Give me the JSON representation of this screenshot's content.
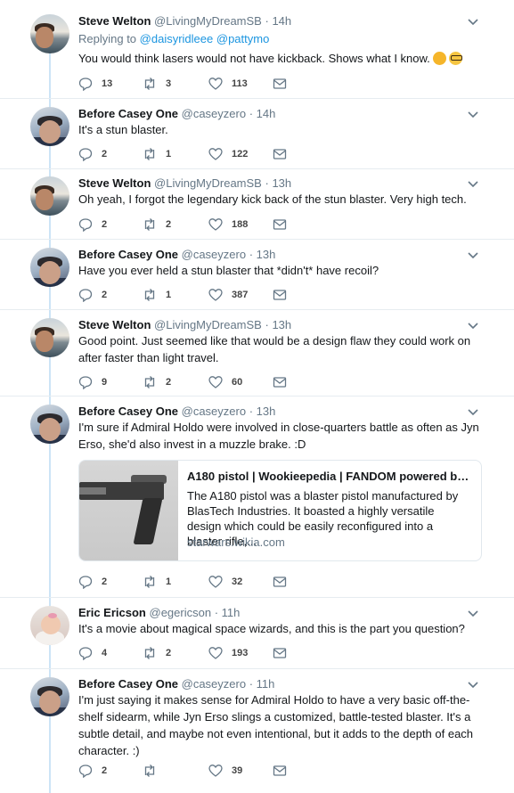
{
  "tweets": [
    {
      "name": "Steve Welton",
      "handle": "@LivingMyDreamSB",
      "time": "14h",
      "replying_label": "Replying to",
      "replying_to": [
        "@daisyridleee",
        "@pattymo"
      ],
      "text": "You would think lasers would not have kickback. Shows what I know.",
      "emojis": [
        "thinking-face-emoji",
        "nerd-face-emoji"
      ],
      "replies": "13",
      "retweets": "3",
      "likes": "113"
    },
    {
      "name": "Before Casey One",
      "handle": "@caseyzero",
      "time": "14h",
      "text": "It's a stun blaster.",
      "replies": "2",
      "retweets": "1",
      "likes": "122"
    },
    {
      "name": "Steve Welton",
      "handle": "@LivingMyDreamSB",
      "time": "13h",
      "text": "Oh yeah, I forgot the legendary kick back of the stun blaster. Very high tech.",
      "replies": "2",
      "retweets": "2",
      "likes": "188"
    },
    {
      "name": "Before Casey One",
      "handle": "@caseyzero",
      "time": "13h",
      "text": "Have you ever held a stun blaster that *didn't* have recoil?",
      "replies": "2",
      "retweets": "1",
      "likes": "387"
    },
    {
      "name": "Steve Welton",
      "handle": "@LivingMyDreamSB",
      "time": "13h",
      "text": "Good point. Just seemed like that would be a design flaw they could work on after faster than light travel.",
      "replies": "9",
      "retweets": "2",
      "likes": "60"
    },
    {
      "name": "Before Casey One",
      "handle": "@caseyzero",
      "time": "13h",
      "text": "I'm sure if Admiral Holdo were involved in close-quarters battle as often as Jyn Erso, she'd also invest in a muzzle brake.  :D",
      "card": {
        "title": "A180 pistol | Wookieepedia | FANDOM powered by ...",
        "description": "The A180 pistol was a blaster pistol manufactured by BlasTech Industries. It boasted a highly versatile design which could be easily reconfigured into a blaster rifle,...",
        "domain": "starwars.wikia.com"
      },
      "replies": "2",
      "retweets": "1",
      "likes": "32"
    },
    {
      "name": "Eric Ericson",
      "handle": "@egericson",
      "time": "11h",
      "text": "It's a movie about magical space wizards, and this is the part you question?",
      "replies": "4",
      "retweets": "2",
      "likes": "193"
    },
    {
      "name": "Before Casey One",
      "handle": "@caseyzero",
      "time": "11h",
      "text": "I'm just saying it makes sense for Admiral Holdo to have a very basic off-the-shelf sidearm, while Jyn Erso slings a customized, battle-tested blaster. It's a subtle detail, and maybe not even intentional, but it adds to the depth of each character.  :)",
      "replies": "2",
      "retweets": "",
      "likes": "39"
    }
  ],
  "colors": {
    "link": "#1b95e0",
    "secondary_text": "#657786",
    "thread_line": "#cce4f6",
    "divider": "#e6ecf0"
  },
  "icons": {
    "reply": "reply-icon",
    "retweet": "retweet-icon",
    "like": "heart-icon",
    "dm": "envelope-icon",
    "menu": "chevron-down-icon"
  }
}
